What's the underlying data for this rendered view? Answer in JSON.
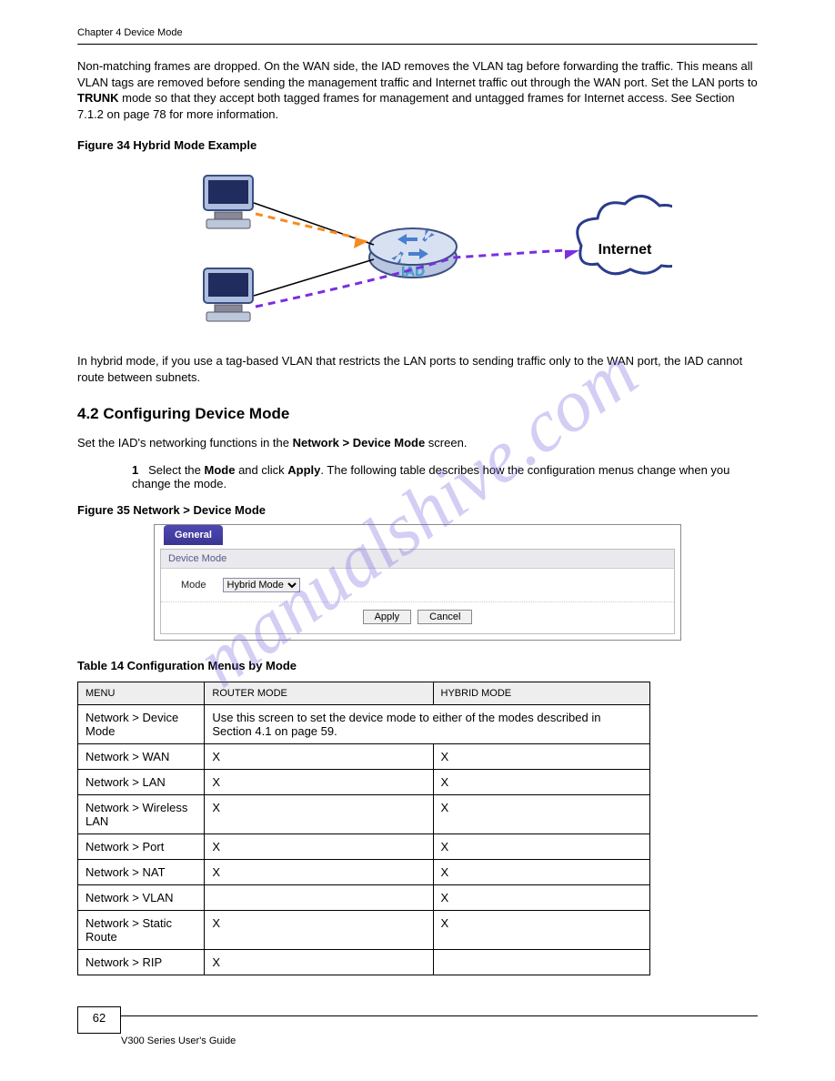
{
  "chapter_header": "Chapter 4 Device Mode",
  "intro_para_a": "Non-matching frames are dropped. On the WAN side, the IAD removes the VLAN tag before forwarding the traffic. This means all VLAN tags are removed before sending the management traffic and Internet traffic out through the WAN port. Set the LAN ports to ",
  "intro_bold1": "TRUNK",
  "intro_para_b": " mode so that they accept both tagged frames for management and untagged frames for Internet access. See ",
  "intro_link": "Section 7.1.2 on page 78",
  "intro_para_c": " for more information.",
  "fig_caption_1": "Figure 34   Hybrid Mode Example",
  "fig_labels": {
    "iad": "IAD",
    "internet": "Internet"
  },
  "hybrid_note_a": "In hybrid mode, if you use a tag-based VLAN that restricts the LAN ports to sending traffic only to the WAN port, the IAD cannot route between subnets.",
  "section_heading": "4.2  Configuring Device Mode",
  "section_intro_a": "Set the IAD's networking functions in the ",
  "section_bold_b": "Network > Device Mode",
  "section_intro_b": " screen.",
  "step_num": "1",
  "step_text_a": "Select the ",
  "step_bold": "Mode",
  "step_text_b": " and click ",
  "step_bold2": "Apply",
  "step_text_c": ". The following table describes how the configuration menus change when you change the mode.",
  "fig_caption_2": "Figure 35   Network > Device Mode",
  "screenshot": {
    "tab": "General",
    "panel_header": "Device Mode",
    "mode_label": "Mode",
    "mode_value": "Hybrid Mode",
    "apply": "Apply",
    "cancel": "Cancel"
  },
  "table_caption": "Table 14   Configuration Menus by Mode",
  "table_headers": [
    "MENU",
    "ROUTER MODE",
    "HYBRID MODE"
  ],
  "table_rows": [
    {
      "menu": "Network > Device Mode",
      "router": "Use this screen to set the device mode to either of the modes described in Section 4.1 on page 59.",
      "hybrid": ""
    },
    {
      "menu": "Network > WAN",
      "router": "X",
      "hybrid": "X"
    },
    {
      "menu": "Network > LAN",
      "router": "X",
      "hybrid": "X"
    },
    {
      "menu": "Network > Wireless LAN",
      "router": "X",
      "hybrid": "X"
    },
    {
      "menu": "Network > Port",
      "router": "X",
      "hybrid": "X"
    },
    {
      "menu": "Network > NAT",
      "router": "X",
      "hybrid": "X"
    },
    {
      "menu": "Network > VLAN",
      "router": "",
      "hybrid": "X"
    },
    {
      "menu": "Network > Static Route",
      "router": "X",
      "hybrid": "X"
    },
    {
      "menu": "Network > RIP",
      "router": "X",
      "hybrid": ""
    }
  ],
  "page_number": "62",
  "footer_text": "V300 Series User's Guide",
  "watermark": "manualshive.com"
}
